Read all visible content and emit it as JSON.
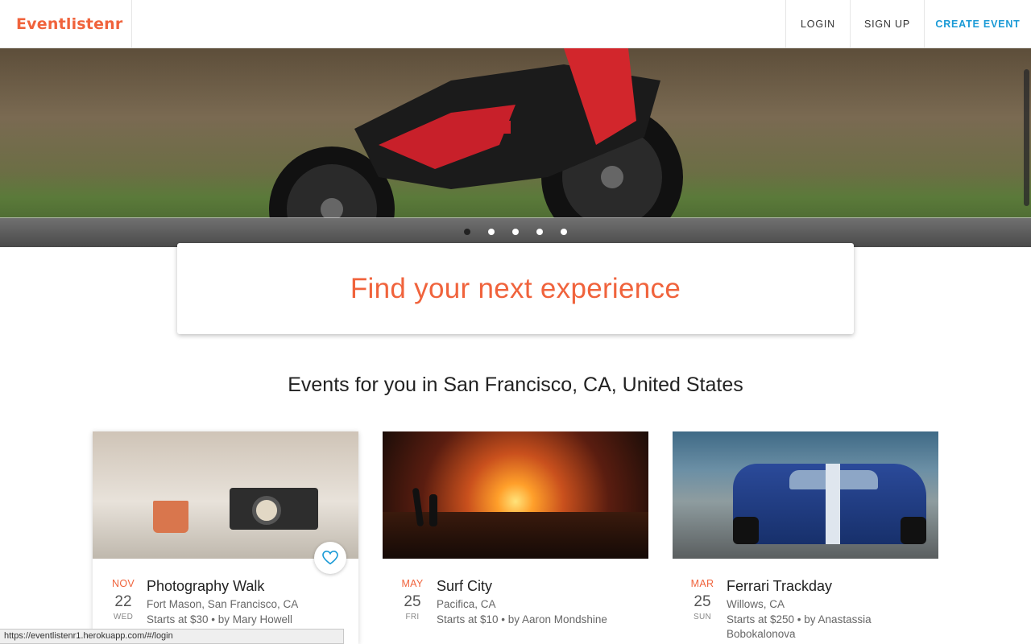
{
  "header": {
    "logo": "Eventlistenr",
    "nav": {
      "login": "LOGIN",
      "signup": "SIGN UP",
      "create": "CREATE EVENT"
    }
  },
  "hero": {
    "slide_count": 5,
    "active_slide": 1
  },
  "search": {
    "placeholder": "Find your next experience"
  },
  "section_title": "Events for you in San Francisco, CA, United States",
  "events": [
    {
      "month": "NOV",
      "day": "22",
      "weekday": "WED",
      "title": "Photography Walk",
      "location": "Fort Mason, San Francisco, CA",
      "price_host": "Starts at $30 • by Mary Howell",
      "image": "camera-and-mug-photo"
    },
    {
      "month": "MAY",
      "day": "25",
      "weekday": "FRI",
      "title": "Surf City",
      "location": "Pacifica, CA",
      "price_host": "Starts at $10 • by Aaron Mondshine",
      "image": "sunset-surfer-photo"
    },
    {
      "month": "MAR",
      "day": "25",
      "weekday": "SUN",
      "title": "Ferrari Trackday",
      "location": "Willows, CA",
      "price_host": "Starts at $250 • by Anastassia Bobokalonova",
      "image": "blue-race-car-photo"
    }
  ],
  "status_url": "https://eventlistenr1.herokuapp.com/#/login",
  "colors": {
    "brand": "#f0633c",
    "accent": "#1a9ad6"
  },
  "icons": {
    "favorite": "heart-outline-icon"
  }
}
